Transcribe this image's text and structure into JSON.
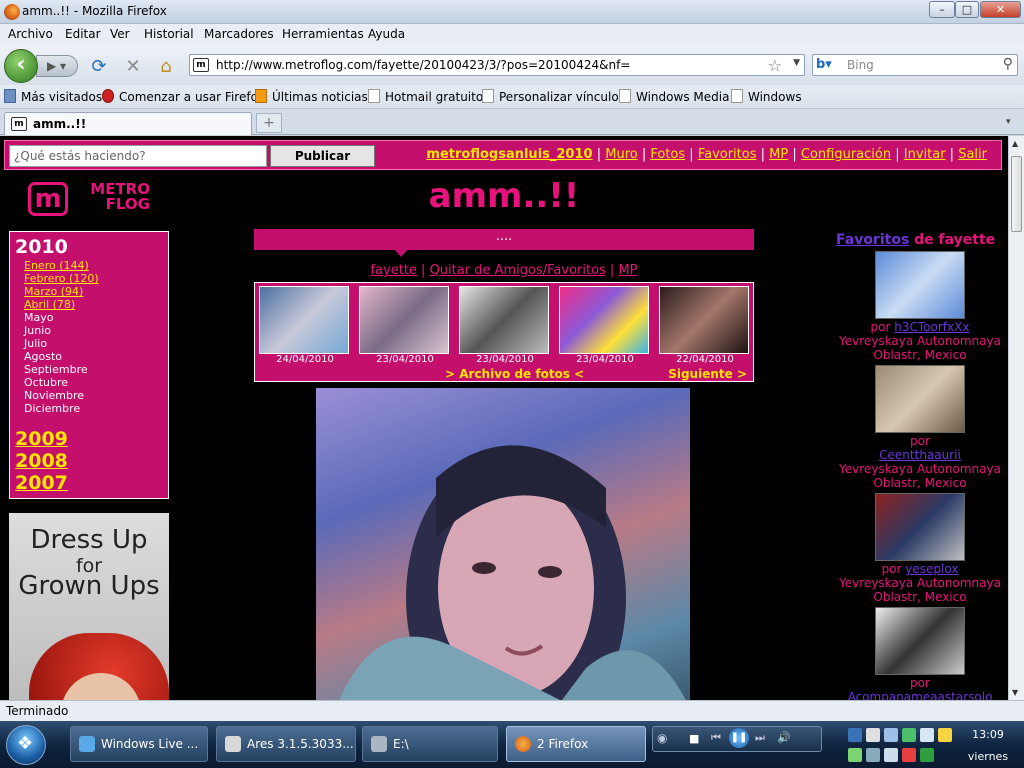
{
  "window": {
    "title": "amm..!! - Mozilla Firefox",
    "min": "–",
    "max": "□",
    "close": "✕"
  },
  "menu": [
    "Archivo",
    "Editar",
    "Ver",
    "Historial",
    "Marcadores",
    "Herramientas",
    "Ayuda"
  ],
  "nav": {
    "url": "http://www.metroflog.com/fayette/20100423/3/?pos=20100424&nf=",
    "search_placeholder": "Bing",
    "back_icon": "back-arrow-icon",
    "forward_icon": "forward-arrow-icon"
  },
  "bookmarks": [
    "Más visitados",
    "Comenzar a usar Firefox",
    "Últimas noticias",
    "Hotmail gratuito",
    "Personalizar vínculos",
    "Windows Media",
    "Windows"
  ],
  "tab": {
    "label": "amm..!!"
  },
  "page": {
    "status_placeholder": "¿Qué estás haciendo?",
    "publish": "Publicar",
    "user": "metroflogsanluis_2010",
    "links": [
      "Muro",
      "Fotos",
      "Favoritos",
      "MP",
      "Configuración",
      "Invitar",
      "Salir"
    ],
    "logo_letter": "m",
    "logo_text": [
      "METRO",
      "FLOG"
    ],
    "title": "amm..!!",
    "bar_text": "....",
    "sub_links": [
      "fayette",
      "Quitar de Amigos/Favoritos",
      "MP"
    ],
    "thumb_dates": [
      "24/04/2010",
      "23/04/2010",
      "23/04/2010",
      "23/04/2010",
      "22/04/2010"
    ],
    "archive_link": ">  Archivo de fotos  <",
    "next_link": "Siguiente >",
    "archive": {
      "year": "2010",
      "months": [
        "Enero (144)",
        "Febrero (120)",
        "Marzo (94)",
        "Abril (78)",
        "Mayo",
        "Junio",
        "Julio",
        "Agosto",
        "Septiembre",
        "Octubre",
        "Noviembre",
        "Diciembre"
      ],
      "older_years": [
        "2009",
        "2008",
        "2007"
      ]
    },
    "ad_lines": [
      "Dress Up",
      "for",
      "Grown Ups"
    ],
    "favoritos": {
      "head_link": "Favoritos",
      "head_rest": " de fayette",
      "items": [
        {
          "by": "por ",
          "user": "h3CToorfxXx",
          "loc": "Yevreyskaya Autonomnaya Oblastr, Mexico"
        },
        {
          "by": "por ",
          "user": "Ceentthaaurii",
          "loc": "Yevreyskaya Autonomnaya Oblastr, Mexico"
        },
        {
          "by": "por ",
          "user": "yeseplox",
          "loc": "Yevreyskaya Autonomnaya Oblastr, Mexico"
        },
        {
          "by": "por ",
          "user": "Acompanameaastarsolo",
          "loc": ""
        }
      ]
    }
  },
  "status": "Terminado",
  "taskbar": {
    "buttons": [
      "Windows Live ...",
      "Ares 3.1.5.3033...",
      "E:\\",
      "2 Firefox"
    ],
    "time": "13:09",
    "day": "viernes"
  }
}
